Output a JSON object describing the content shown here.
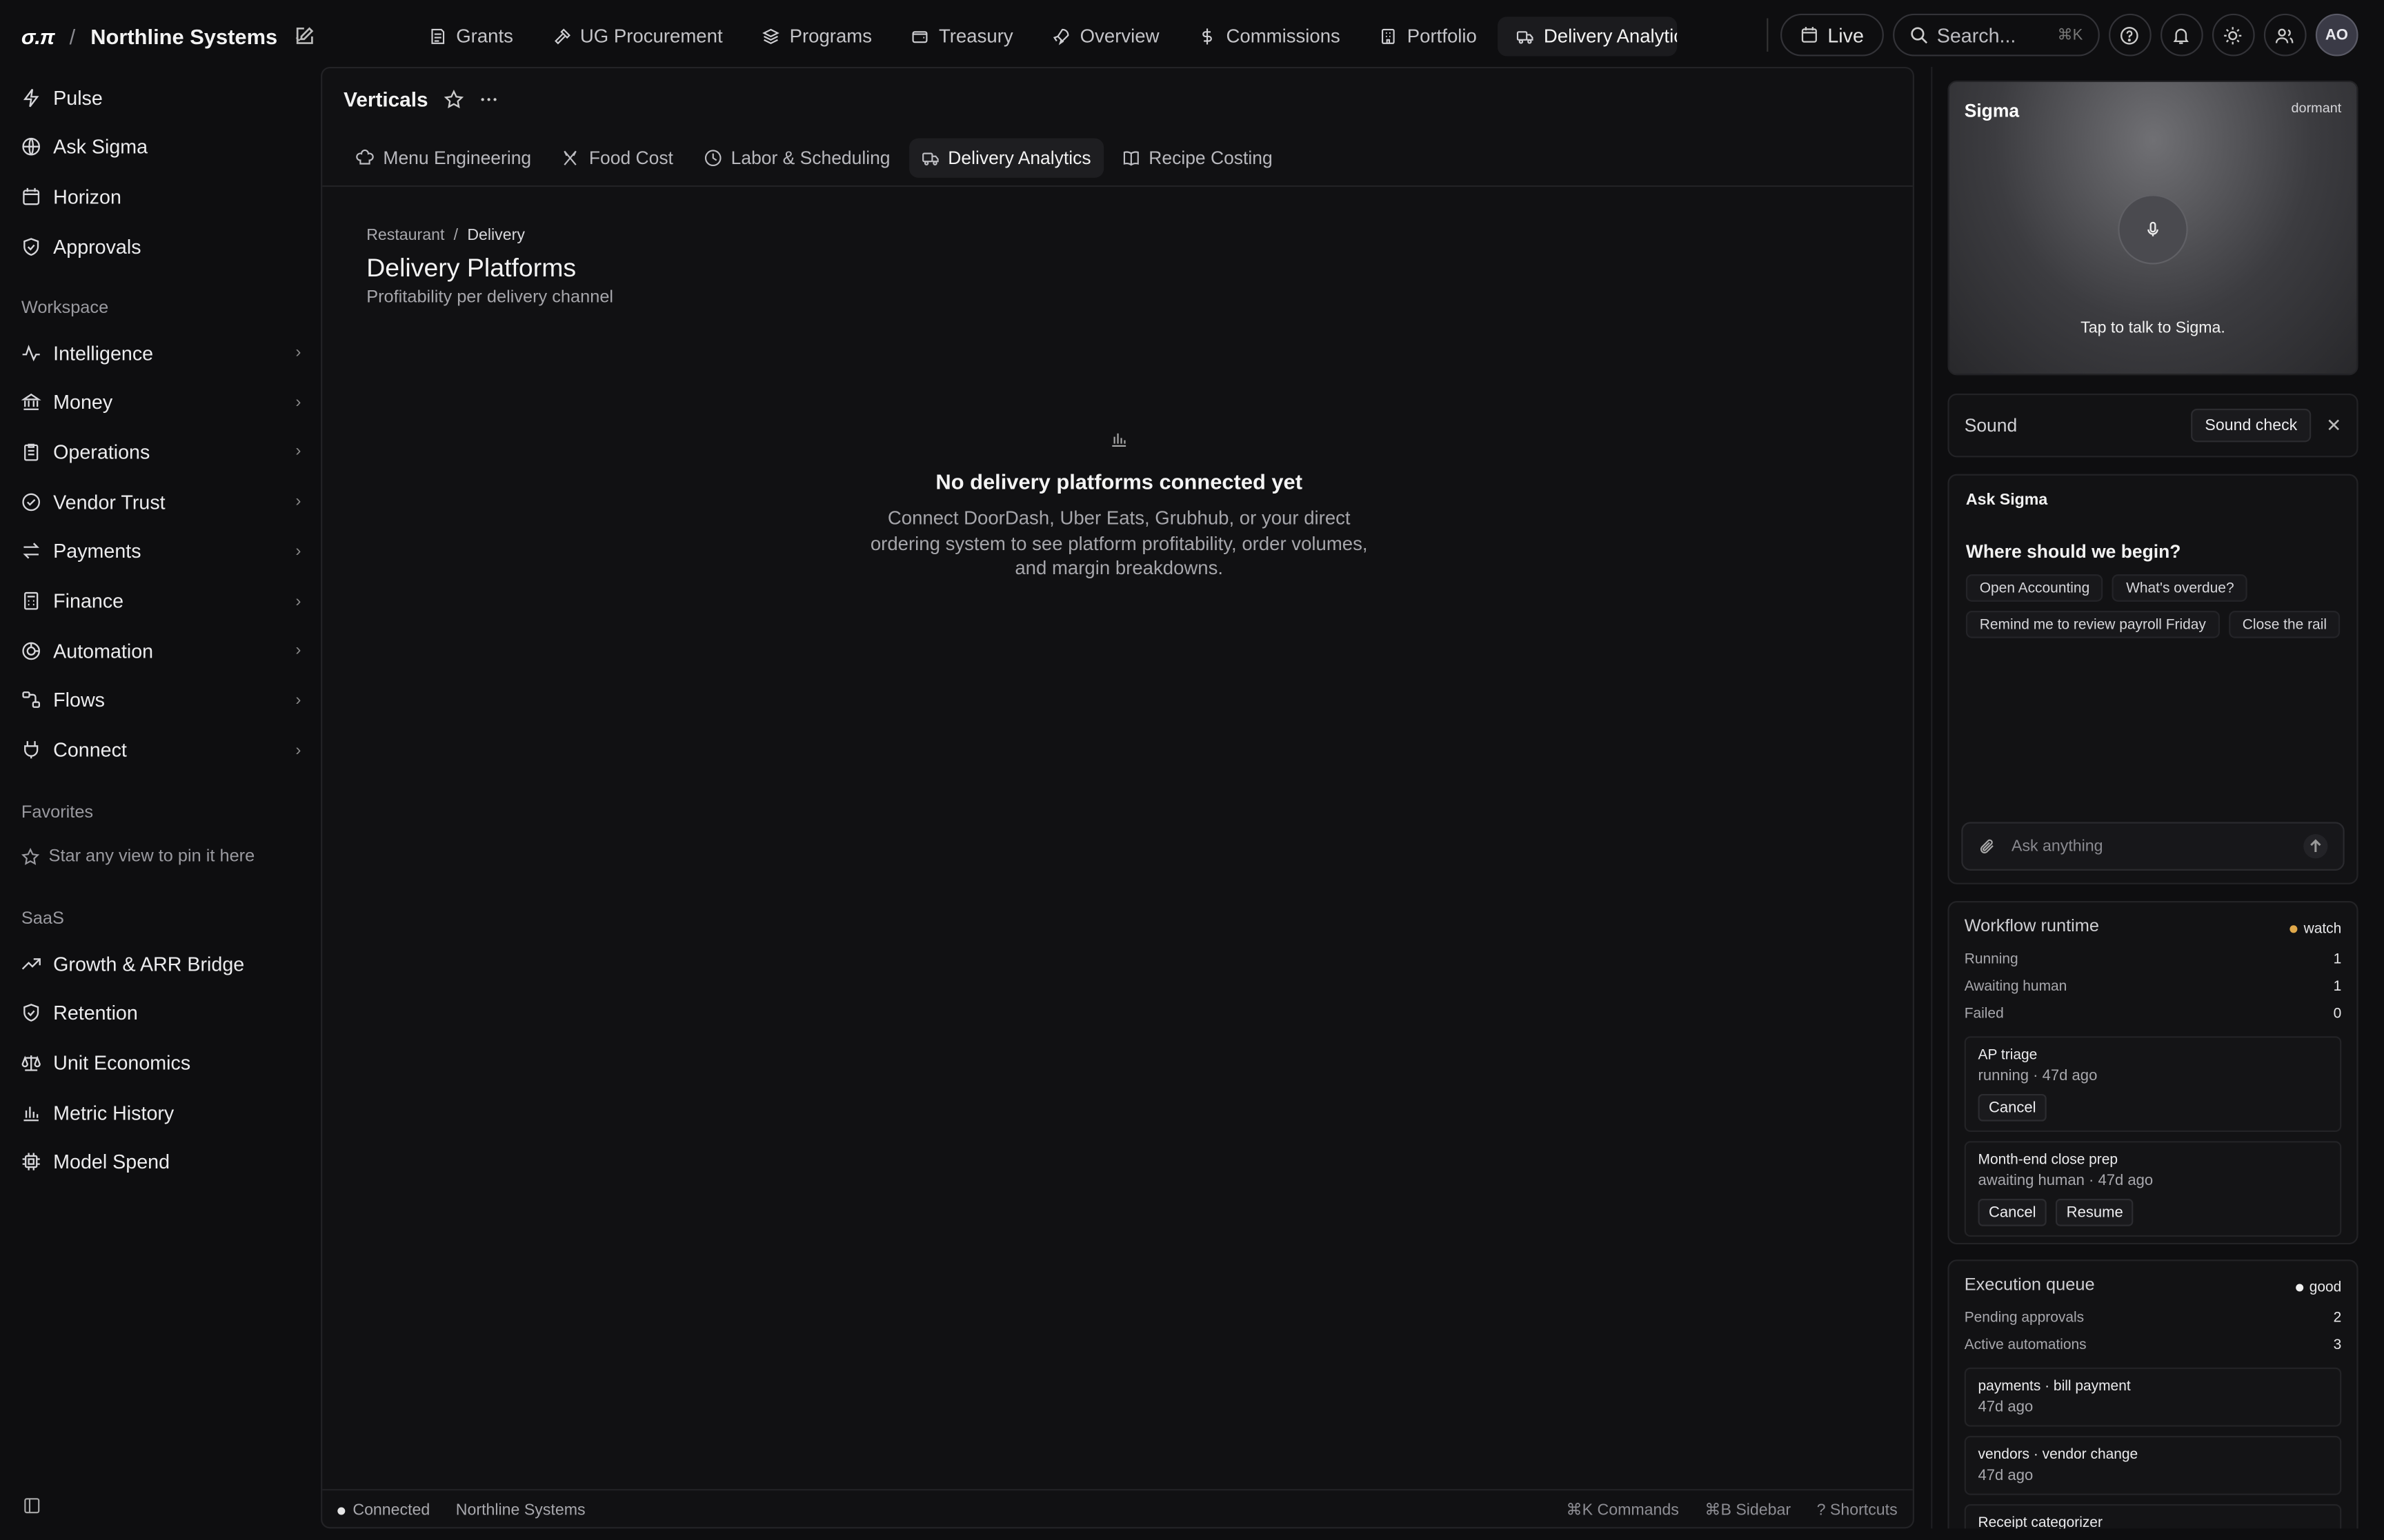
{
  "app": {
    "logo": "σ.π",
    "org": "Northline Systems"
  },
  "topnav": [
    {
      "label": "Grants",
      "icon": "grants-icon"
    },
    {
      "label": "UG Procurement",
      "icon": "gavel-icon"
    },
    {
      "label": "Programs",
      "icon": "layers-icon"
    },
    {
      "label": "Treasury",
      "icon": "wallet-icon"
    },
    {
      "label": "Overview",
      "icon": "rocket-icon"
    },
    {
      "label": "Commissions",
      "icon": "dollar-icon"
    },
    {
      "label": "Portfolio",
      "icon": "building-icon"
    },
    {
      "label": "Delivery Analytics",
      "icon": "truck-icon",
      "active": true
    }
  ],
  "topright": {
    "live": "Live",
    "search_placeholder": "Search...",
    "search_kbd": "⌘K",
    "avatar": "AO"
  },
  "sidebar": {
    "primary": [
      "Pulse",
      "Ask Sigma",
      "Horizon",
      "Approvals"
    ],
    "workspace_heading": "Workspace",
    "workspace": [
      "Intelligence",
      "Money",
      "Operations",
      "Vendor Trust",
      "Payments",
      "Finance",
      "Automation",
      "Flows",
      "Connect"
    ],
    "favorites_heading": "Favorites",
    "favorites_empty": "Star any view to pin it here",
    "saas_heading": "SaaS",
    "saas": [
      "Growth & ARR Bridge",
      "Retention",
      "Unit Economics",
      "Metric History",
      "Model Spend"
    ]
  },
  "main": {
    "header": "Verticals",
    "tabs": [
      {
        "label": "Menu Engineering",
        "icon": "chef-hat-icon"
      },
      {
        "label": "Food Cost",
        "icon": "utensils-icon"
      },
      {
        "label": "Labor & Scheduling",
        "icon": "clock-icon"
      },
      {
        "label": "Delivery Analytics",
        "icon": "truck-icon",
        "active": true
      },
      {
        "label": "Recipe Costing",
        "icon": "book-icon"
      }
    ],
    "breadcrumb": [
      "Restaurant",
      "Delivery"
    ],
    "title": "Delivery Platforms",
    "subtitle": "Profitability per delivery channel",
    "empty_title": "No delivery platforms connected yet",
    "empty_desc": "Connect DoorDash, Uber Eats, Grubhub, or your direct ordering system to see platform profitability, order volumes, and margin breakdowns.",
    "footer": {
      "status": "Connected",
      "org": "Northline Systems",
      "commands": "⌘K Commands",
      "sidebar": "⌘B Sidebar",
      "shortcuts": "? Shortcuts"
    }
  },
  "rail": {
    "sigma": {
      "title": "Sigma",
      "state": "dormant",
      "caption": "Tap to talk to Sigma."
    },
    "sound": {
      "label": "Sound",
      "button": "Sound check"
    },
    "ask": {
      "title": "Ask Sigma",
      "question": "Where should we begin?",
      "chips": [
        "Open Accounting",
        "What's overdue?",
        "Remind me to review payroll Friday",
        "Close the rail"
      ],
      "placeholder": "Ask anything"
    },
    "workflow": {
      "title": "Workflow runtime",
      "badge": "watch",
      "badge_color": "#e0a84a",
      "rows": [
        {
          "label": "Running",
          "value": "1"
        },
        {
          "label": "Awaiting human",
          "value": "1"
        },
        {
          "label": "Failed",
          "value": "0"
        }
      ],
      "jobs": [
        {
          "name": "AP triage",
          "status": "running · 47d ago",
          "buttons": [
            "Cancel"
          ]
        },
        {
          "name": "Month-end close prep",
          "status": "awaiting human · 47d ago",
          "buttons": [
            "Cancel",
            "Resume"
          ]
        }
      ]
    },
    "queue": {
      "title": "Execution queue",
      "badge": "good",
      "badge_color": "#f0f0f0",
      "rows": [
        {
          "label": "Pending approvals",
          "value": "2"
        },
        {
          "label": "Active automations",
          "value": "3"
        }
      ],
      "items": [
        {
          "name": "payments · bill payment",
          "status": "47d ago"
        },
        {
          "name": "vendors · vendor change",
          "status": "47d ago"
        },
        {
          "name": "Receipt categorizer",
          "status": ""
        }
      ]
    }
  }
}
